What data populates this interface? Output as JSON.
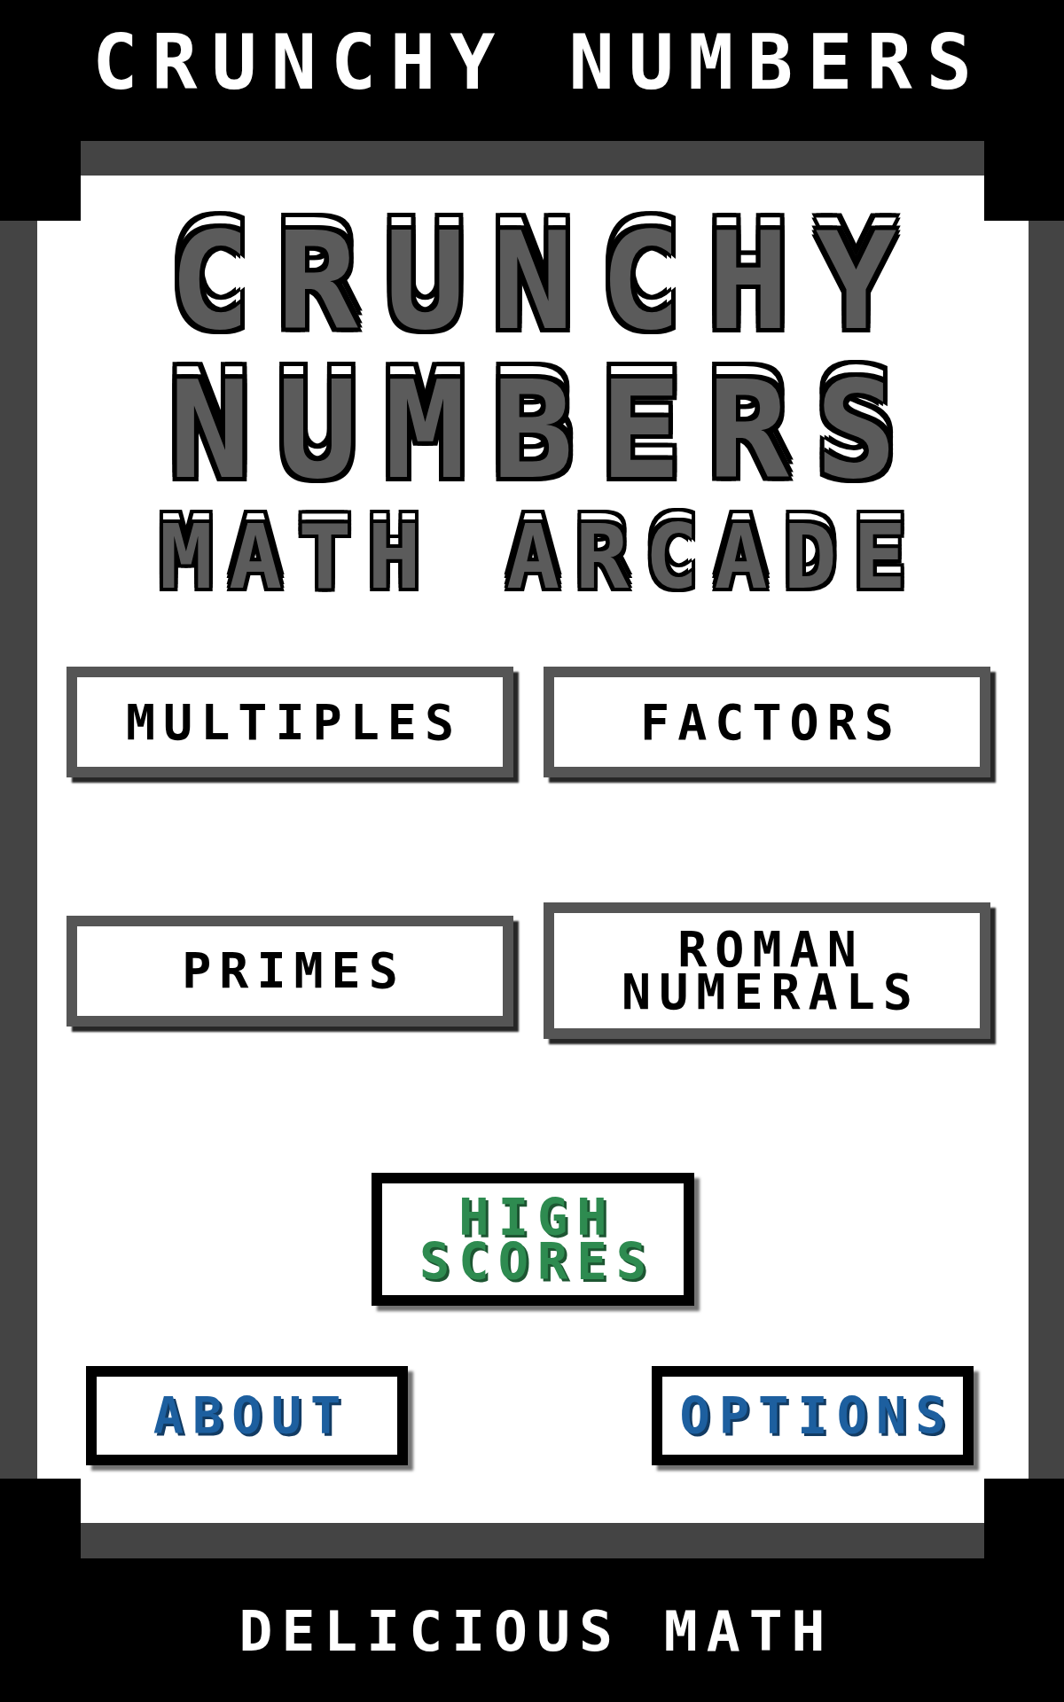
{
  "header": {
    "title": "CRUNCHY NUMBERS"
  },
  "logo": {
    "title": "CRUNCHY NUMBERS",
    "subtitle": "MATH ARCADE"
  },
  "game_modes": [
    {
      "label": "MULTIPLES"
    },
    {
      "label": "FACTORS"
    },
    {
      "label": "PRIMES"
    },
    {
      "label": "ROMAN NUMERALS"
    }
  ],
  "menu": [
    {
      "label": "HIGH SCORES",
      "color": "#2e8b50"
    },
    {
      "label": "ABOUT",
      "color": "#1d5f9f"
    },
    {
      "label": "OPTIONS",
      "color": "#1d5f9f"
    }
  ],
  "footer": {
    "tagline": "DELICIOUS MATH"
  }
}
